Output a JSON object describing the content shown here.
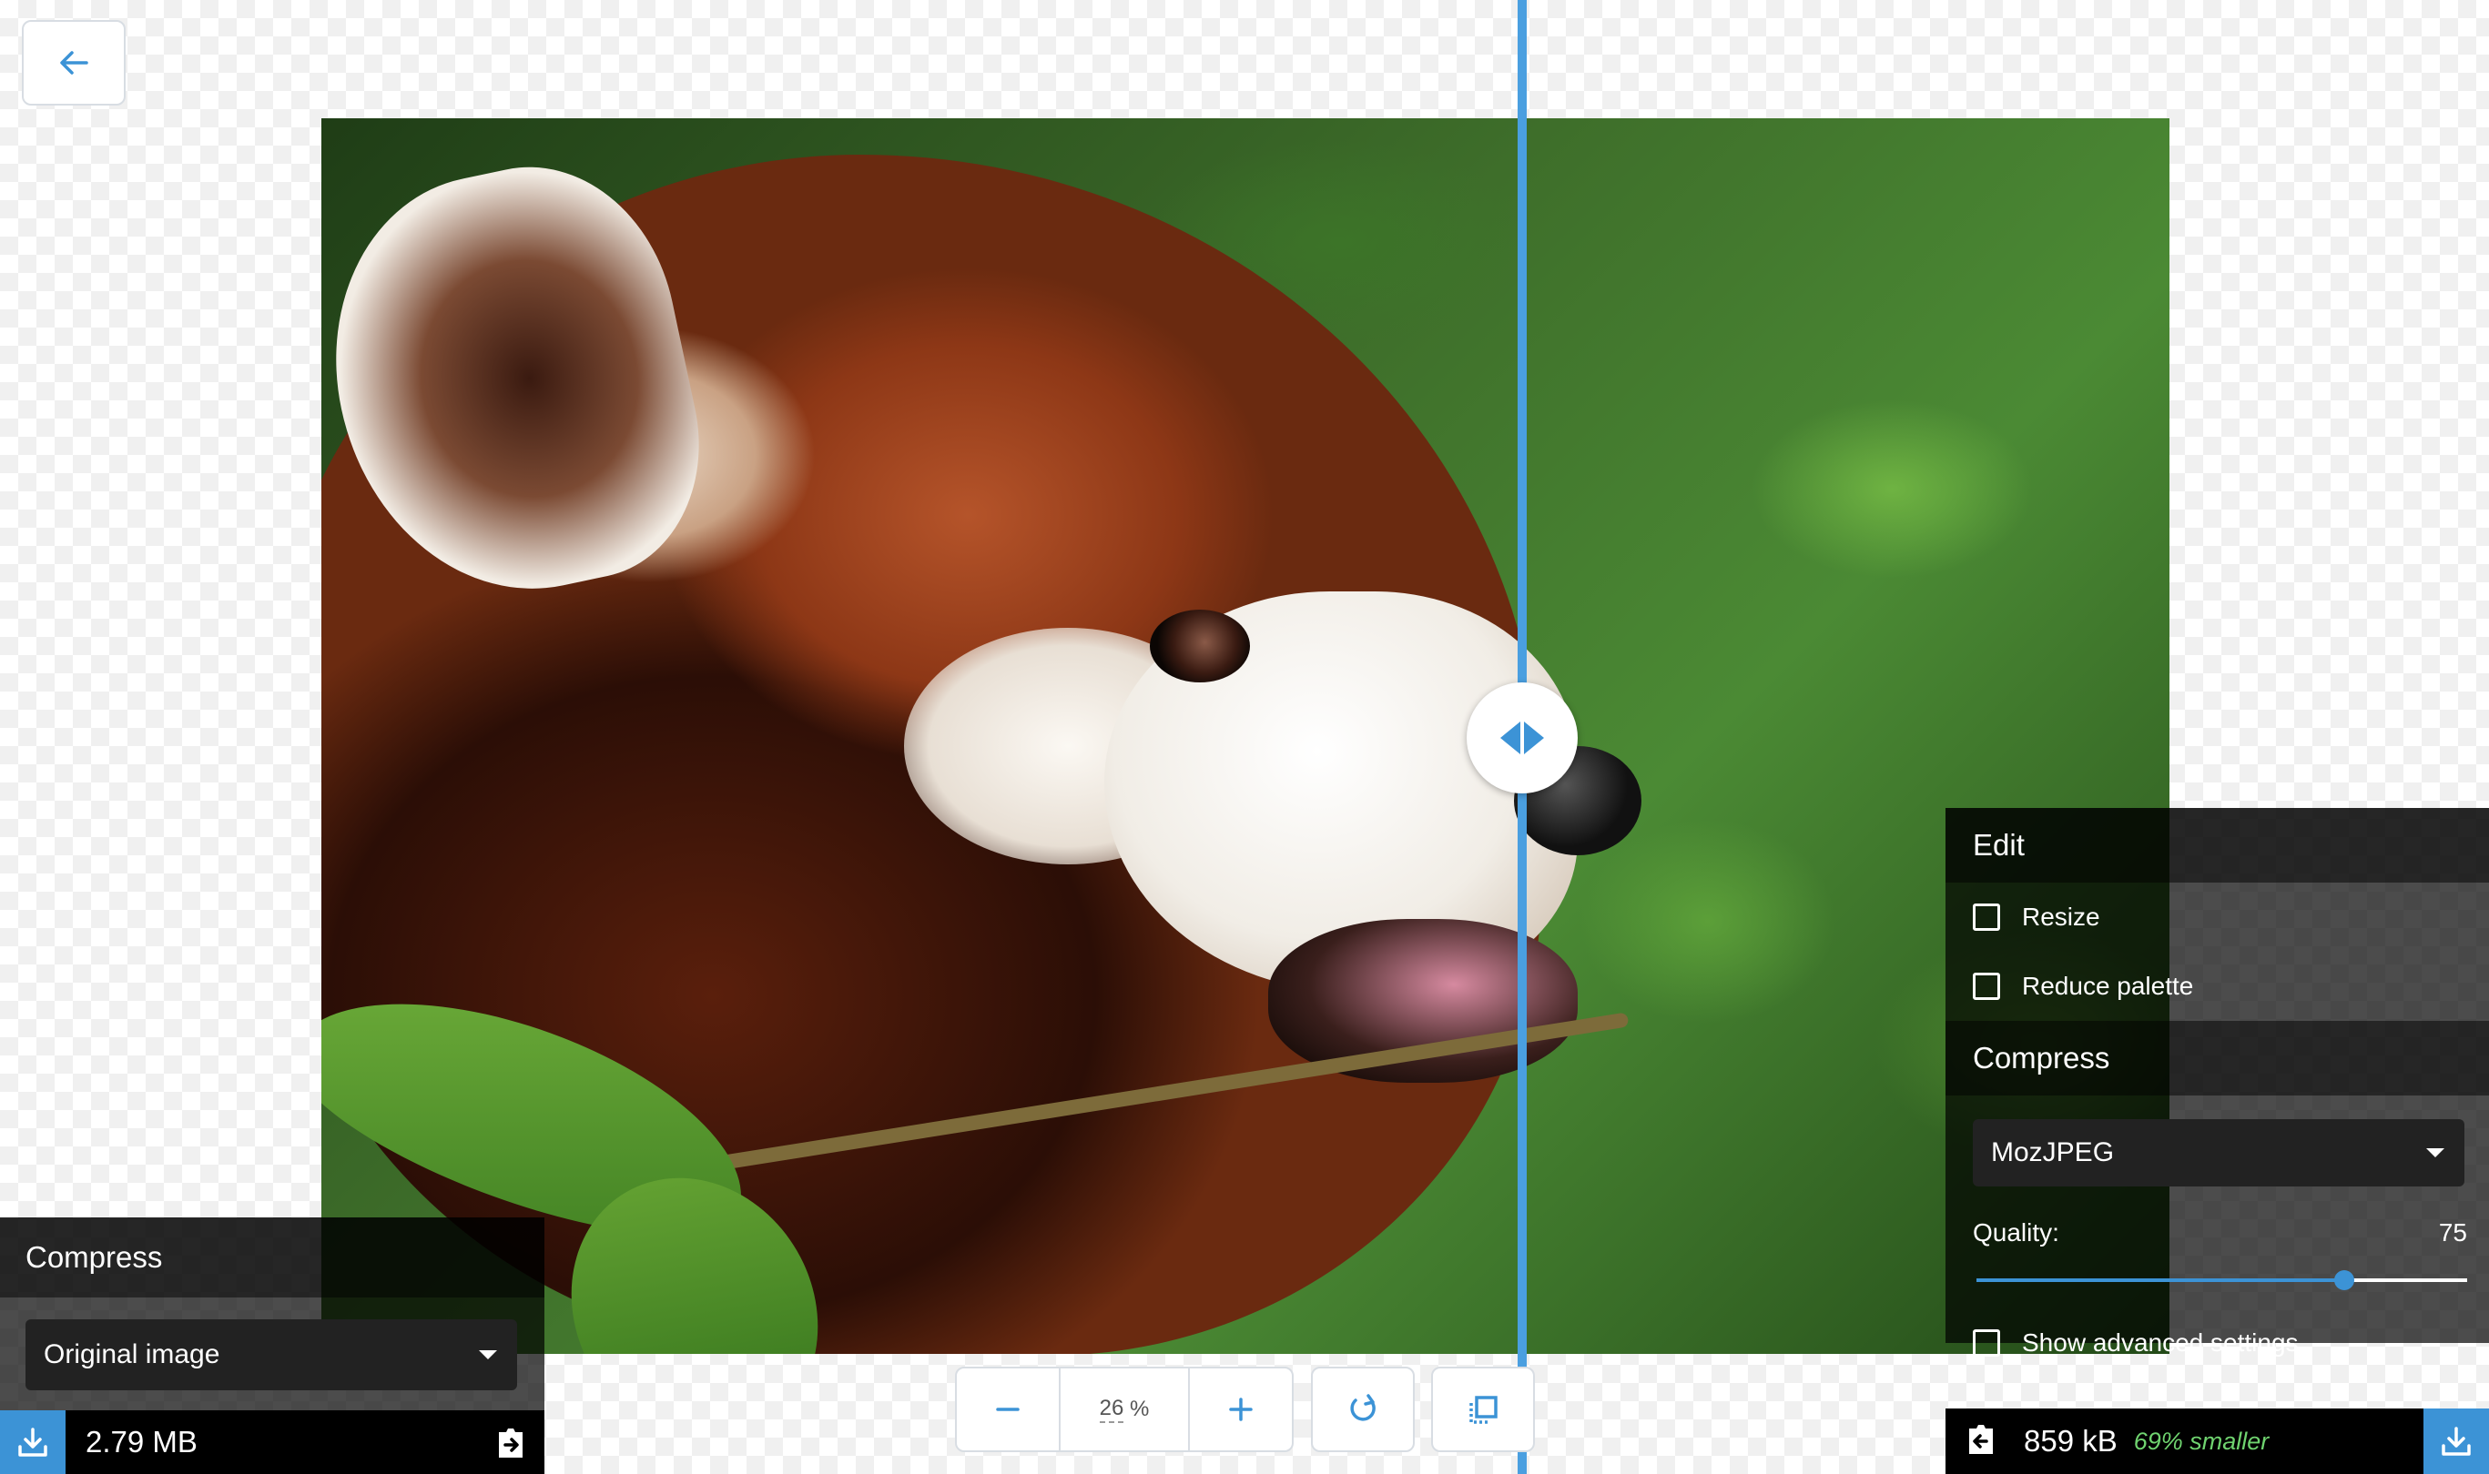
{
  "left_panel": {
    "title": "Compress",
    "select_value": "Original image",
    "file_size": "2.79 MB"
  },
  "right_panel": {
    "edit_title": "Edit",
    "resize_label": "Resize",
    "reduce_palette_label": "Reduce palette",
    "compress_title": "Compress",
    "codec_value": "MozJPEG",
    "quality_label": "Quality:",
    "quality_value": "75",
    "quality_level": 0.75,
    "advanced_label": "Show advanced settings",
    "file_size": "859 kB",
    "savings": "69% smaller"
  },
  "zoom": {
    "value": "26",
    "unit": "%"
  },
  "colors": {
    "accent": "#3c93d6",
    "savings": "#6fd36f"
  },
  "icons": [
    "back-arrow-icon",
    "compare-handle-icon",
    "download-icon",
    "copy-to-side-icon",
    "minus-icon",
    "plus-icon",
    "rotate-icon",
    "background-toggle-icon",
    "chevron-down-icon"
  ]
}
